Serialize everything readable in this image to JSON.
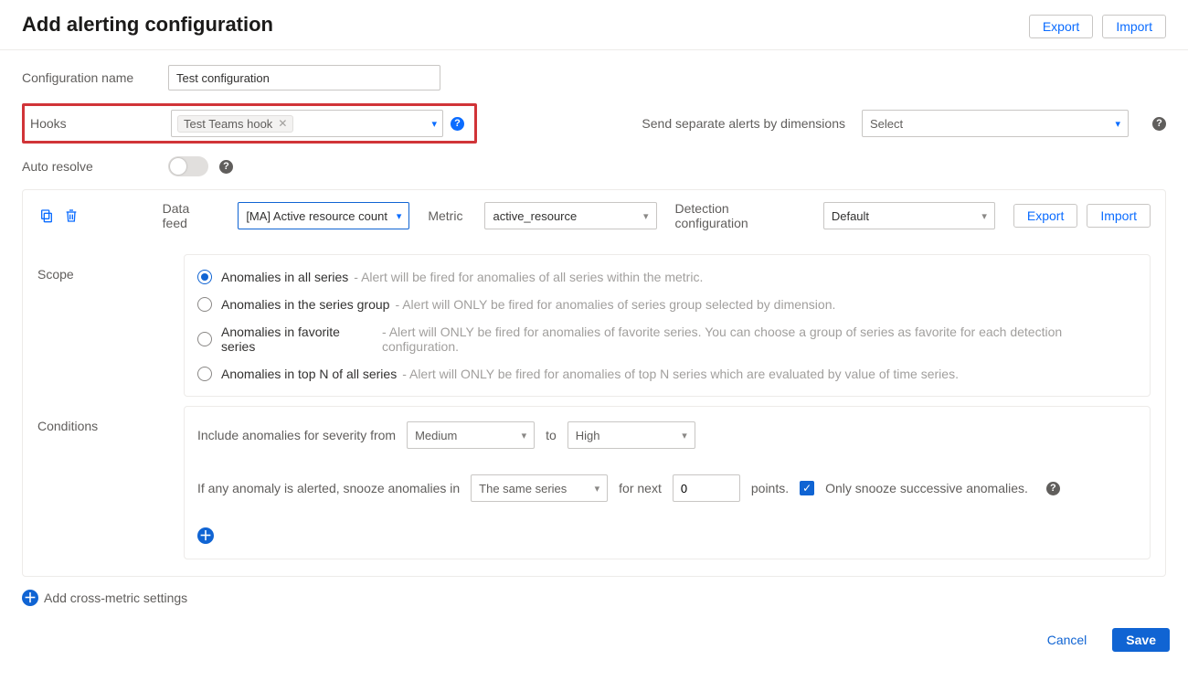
{
  "header": {
    "title": "Add alerting configuration",
    "export": "Export",
    "import": "Import"
  },
  "form": {
    "config_name_label": "Configuration name",
    "config_name_value": "Test configuration",
    "hooks_label": "Hooks",
    "hook_tag": "Test Teams hook",
    "dim_label": "Send separate alerts by dimensions",
    "dim_placeholder": "Select",
    "auto_resolve_label": "Auto resolve"
  },
  "card": {
    "data_feed_label": "Data feed",
    "data_feed_value": "[MA] Active resource count",
    "metric_label": "Metric",
    "metric_value": "active_resource",
    "detection_label": "Detection configuration",
    "detection_value": "Default",
    "export": "Export",
    "import": "Import"
  },
  "scope": {
    "label": "Scope",
    "options": [
      {
        "title": "Anomalies in all series",
        "hint": "- Alert will be fired for anomalies of all series within the metric.",
        "checked": true
      },
      {
        "title": "Anomalies in the series group",
        "hint": "- Alert will ONLY be fired for anomalies of series group selected by dimension.",
        "checked": false
      },
      {
        "title": "Anomalies in favorite series",
        "hint": "- Alert will ONLY be fired for anomalies of favorite series. You can choose a group of series as favorite for each detection configuration.",
        "checked": false
      },
      {
        "title": "Anomalies in top N of all series",
        "hint": "- Alert will ONLY be fired for anomalies of top N series which are evaluated by value of time series.",
        "checked": false
      }
    ]
  },
  "conditions": {
    "label": "Conditions",
    "severity_prefix": "Include anomalies for severity from",
    "severity_from": "Medium",
    "severity_to_label": "to",
    "severity_to": "High",
    "snooze_prefix": "If any anomaly is alerted, snooze anomalies in",
    "snooze_scope": "The same series",
    "snooze_mid": "for next",
    "snooze_count": "0",
    "snooze_suffix": "points.",
    "only_successive": "Only snooze successive anomalies."
  },
  "cross_metric": "Add cross-metric settings",
  "footer": {
    "cancel": "Cancel",
    "save": "Save"
  }
}
